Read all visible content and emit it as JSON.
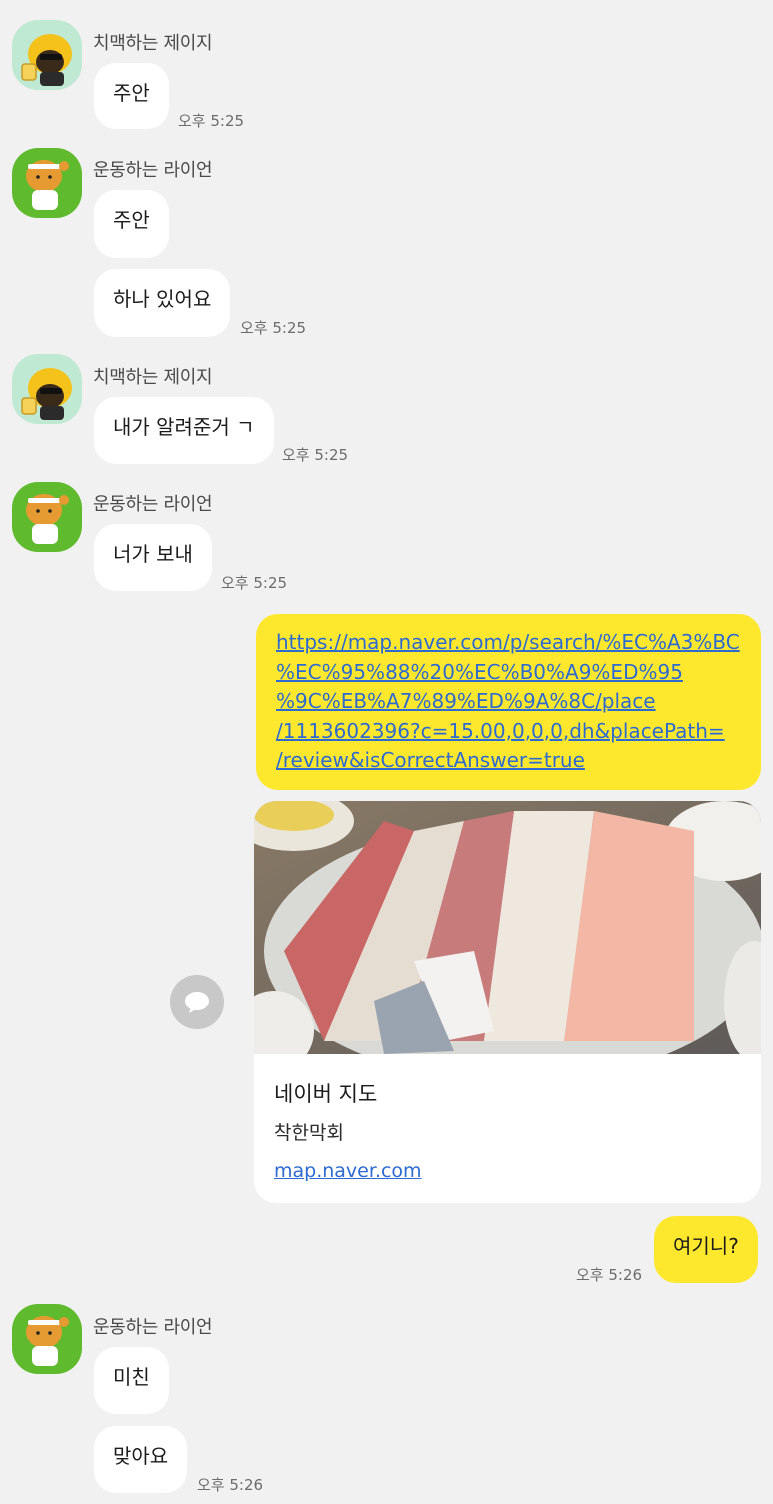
{
  "senders": {
    "jay": "치맥하는 제이지",
    "ryan": "운동하는 라이언"
  },
  "messages": [
    {
      "text": "주안",
      "time": "오후 5:25"
    },
    {
      "text": "주안"
    },
    {
      "text": "하나 있어요",
      "time": "오후 5:25"
    },
    {
      "text": "내가 알려준거 ㄱ",
      "time": "오후 5:25"
    },
    {
      "text": "너가 보내",
      "time": "오후 5:25"
    },
    {
      "text": "여기니?",
      "time": "오후 5:26"
    },
    {
      "text": "미친"
    },
    {
      "text": "맞아요",
      "time": "오후 5:26"
    }
  ],
  "link_message": {
    "lines": [
      "https://map.naver.com/p/search/%EC%A3%BC",
      "%EC%95%88%20%EC%B0%A9%ED%95",
      "%9C%EB%A7%89%ED%9A%8C/place",
      "/1113602396?c=15.00,0,0,0,dh&placePath=",
      "/review&isCorrectAnswer=true"
    ]
  },
  "link_preview": {
    "title": "네이버 지도",
    "place": "착한막회",
    "domain": "map.naver.com"
  },
  "icons": {
    "jay_avatar": "avatar-icon",
    "ryan_avatar": "avatar-icon",
    "share": "share-icon"
  },
  "colors": {
    "background": "#f1f1f1",
    "my_bubble": "#fde82d",
    "other_bubble": "#ffffff",
    "link": "#2d6ad1"
  }
}
